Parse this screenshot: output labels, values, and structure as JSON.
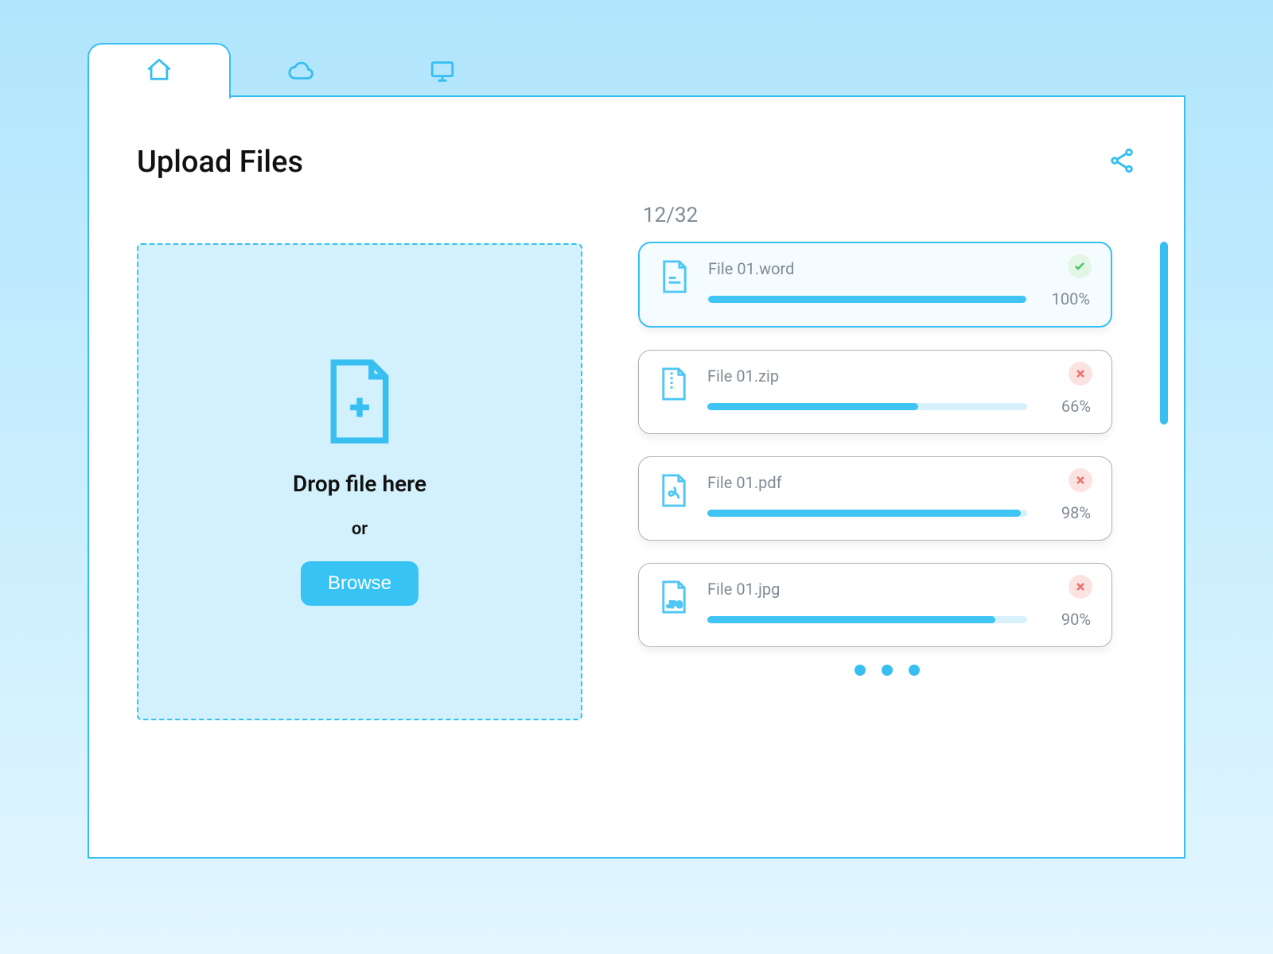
{
  "tabs": [
    {
      "icon": "home-icon",
      "active": true
    },
    {
      "icon": "cloud-icon",
      "active": false
    },
    {
      "icon": "monitor-icon",
      "active": false
    }
  ],
  "header": {
    "title": "Upload Files"
  },
  "dropzone": {
    "primary": "Drop file here",
    "or": "or",
    "browse_label": "Browse"
  },
  "uploads": {
    "count_text": "12/32",
    "files": [
      {
        "name": "File 01.word",
        "type": "word",
        "progress": 100,
        "pct_text": "100%",
        "status": "success",
        "active": true
      },
      {
        "name": "File 01.zip",
        "type": "zip",
        "progress": 66,
        "pct_text": "66%",
        "status": "error",
        "active": false
      },
      {
        "name": "File 01.pdf",
        "type": "pdf",
        "progress": 98,
        "pct_text": "98%",
        "status": "error",
        "active": false
      },
      {
        "name": "File 01.jpg",
        "type": "jpg",
        "progress": 90,
        "pct_text": "90%",
        "status": "error",
        "active": false
      }
    ]
  }
}
